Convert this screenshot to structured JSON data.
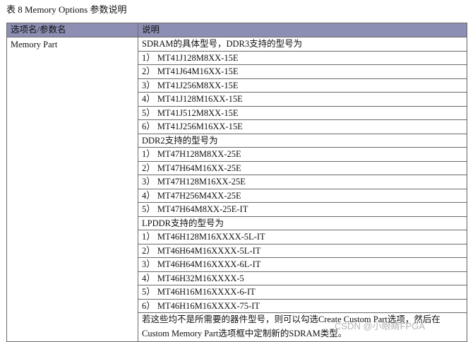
{
  "caption": "表 8   Memory Options 参数说明",
  "headers": [
    "选项名/参数名",
    "说明"
  ],
  "param_name": "Memory Part",
  "lines": [
    "SDRAM的具体型号，DDR3支持的型号为",
    "1） MT41J128M8XX-15E",
    "2） MT41J64M16XX-15E",
    "3） MT41J256M8XX-15E",
    "4） MT41J128M16XX-15E",
    "5） MT41J512M8XX-15E",
    "6） MT41J256M16XX-15E",
    "DDR2支持的型号为",
    "1） MT47H128M8XX-25E",
    "2） MT47H64M16XX-25E",
    "3） MT47H128M16XX-25E",
    "4） MT47H256M4XX-25E",
    "5） MT47H64M8XX-25E-IT",
    "LPDDR支持的型号为",
    "1） MT46H128M16XXXX-5L-IT",
    "2） MT46H64M16XXXX-5L-IT",
    "3） MT46H64M16XXXX-6L-IT",
    "4） MT46H32M16XXXX-5",
    "5） MT46H16M16XXXX-6-IT",
    "6） MT46H16M16XXXX-75-IT"
  ],
  "note": "若这些均不是所需要的器件型号，则可以勾选Create Custom Part选项，然后在Custom Memory Part选项框中定制新的SDRAM类型。",
  "watermark": "CSDN @小眼睛FPGA"
}
